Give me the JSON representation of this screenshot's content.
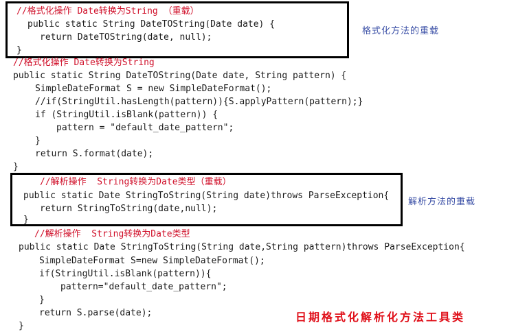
{
  "code": {
    "block1": {
      "comment": "//格式化操作 Date转换为String （重载）",
      "signature": "public static String DateTOString(Date date) {",
      "body": "return DateTOString(date, null);",
      "close": "}"
    },
    "block2": {
      "comment": "//格式化操作 Date转换为String",
      "signature": "public static String DateTOString(Date date, String pattern) {",
      "line1": "SimpleDateFormat S = new SimpleDateFormat();",
      "line2": "//if(StringUtil.hasLength(pattern)){S.applyPattern(pattern);}",
      "line3": "if (StringUtil.isBlank(pattern)) {",
      "line4": "pattern = \"default_date_pattern\";",
      "line5": "}",
      "line6": "return S.format(date);",
      "close": "}"
    },
    "block3": {
      "comment": "//解析操作  String转换为Date类型（重载）",
      "signature": "public static Date StringToString(String date)throws ParseException{",
      "body": "return StringToString(date,null);",
      "close": "}"
    },
    "block4": {
      "comment": "//解析操作  String转换为Date类型",
      "signature": "public static Date StringToString(String date,String pattern)throws ParseException{",
      "line1": "SimpleDateFormat S=new SimpleDateFormat();",
      "line2": "if(StringUtil.isBlank(pattern)){",
      "line3": "pattern=\"default_date_pattern\";",
      "line4": "}",
      "line5": "return S.parse(date);",
      "close": "}"
    }
  },
  "annotations": {
    "format_overload": "格式化方法的重载",
    "parse_overload": "解析方法的重载",
    "title": "日期格式化解析化方法工具类"
  },
  "colors": {
    "comment": "#d0102a",
    "annotation": "#3a4fa6",
    "title": "#e0101a"
  }
}
